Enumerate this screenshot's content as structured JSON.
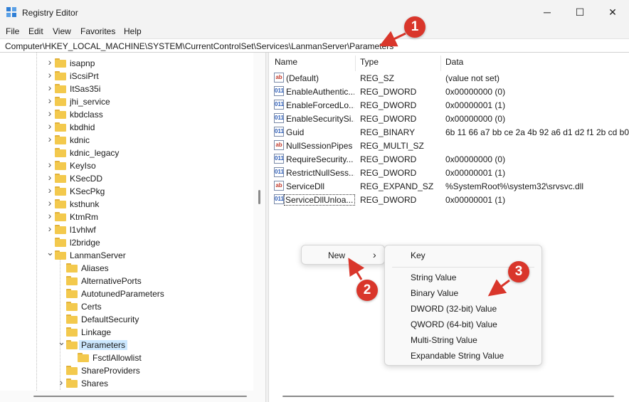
{
  "window": {
    "title": "Registry Editor",
    "minimize_glyph": "─",
    "maximize_glyph": "☐",
    "close_glyph": "✕"
  },
  "menu": [
    "File",
    "Edit",
    "View",
    "Favorites",
    "Help"
  ],
  "address": "Computer\\HKEY_LOCAL_MACHINE\\SYSTEM\\CurrentControlSet\\Services\\LanmanServer\\Parameters",
  "tree": [
    {
      "label": "isapnp",
      "expandable": true
    },
    {
      "label": "iScsiPrt",
      "expandable": true
    },
    {
      "label": "ItSas35i",
      "expandable": true
    },
    {
      "label": "jhi_service",
      "expandable": true
    },
    {
      "label": "kbdclass",
      "expandable": true
    },
    {
      "label": "kbdhid",
      "expandable": true
    },
    {
      "label": "kdnic",
      "expandable": true
    },
    {
      "label": "kdnic_legacy",
      "expandable": false
    },
    {
      "label": "KeyIso",
      "expandable": true
    },
    {
      "label": "KSecDD",
      "expandable": true
    },
    {
      "label": "KSecPkg",
      "expandable": true
    },
    {
      "label": "ksthunk",
      "expandable": true
    },
    {
      "label": "KtmRm",
      "expandable": true
    },
    {
      "label": "l1vhlwf",
      "expandable": true
    },
    {
      "label": "l2bridge",
      "expandable": false
    },
    {
      "label": "LanmanServer",
      "expandable": true,
      "expanded": true
    },
    {
      "label": "Aliases",
      "expandable": false
    },
    {
      "label": "AlternativePorts",
      "expandable": false
    },
    {
      "label": "AutotunedParameters",
      "expandable": false
    },
    {
      "label": "Certs",
      "expandable": false
    },
    {
      "label": "DefaultSecurity",
      "expandable": false
    },
    {
      "label": "Linkage",
      "expandable": false
    },
    {
      "label": "Parameters",
      "expandable": true,
      "expanded": true,
      "selected": true
    },
    {
      "label": "FsctlAllowlist",
      "expandable": false
    },
    {
      "label": "ShareProviders",
      "expandable": false
    },
    {
      "label": "Shares",
      "expandable": true
    }
  ],
  "columns": {
    "name": "Name",
    "type": "Type",
    "data": "Data"
  },
  "values": [
    {
      "icon": "ab",
      "kind": "string-value-icon",
      "name": "(Default)",
      "type": "REG_SZ",
      "data": "(value not set)"
    },
    {
      "icon": "011",
      "kind": "binary-value-icon",
      "name": "EnableAuthentic...",
      "type": "REG_DWORD",
      "data": "0x00000000 (0)"
    },
    {
      "icon": "011",
      "kind": "binary-value-icon",
      "name": "EnableForcedLo...",
      "type": "REG_DWORD",
      "data": "0x00000001 (1)"
    },
    {
      "icon": "011",
      "kind": "binary-value-icon",
      "name": "EnableSecuritySi...",
      "type": "REG_DWORD",
      "data": "0x00000000 (0)"
    },
    {
      "icon": "011",
      "kind": "binary-value-icon",
      "name": "Guid",
      "type": "REG_BINARY",
      "data": "6b 11 66 a7 bb ce 2a 4b 92 a6 d1 d2 f1 2b cd b0"
    },
    {
      "icon": "ab",
      "kind": "string-value-icon",
      "name": "NullSessionPipes",
      "type": "REG_MULTI_SZ",
      "data": ""
    },
    {
      "icon": "011",
      "kind": "binary-value-icon",
      "name": "RequireSecurity...",
      "type": "REG_DWORD",
      "data": "0x00000000 (0)"
    },
    {
      "icon": "011",
      "kind": "binary-value-icon",
      "name": "RestrictNullSess...",
      "type": "REG_DWORD",
      "data": "0x00000001 (1)"
    },
    {
      "icon": "ab",
      "kind": "string-value-icon",
      "name": "ServiceDll",
      "type": "REG_EXPAND_SZ",
      "data": "%SystemRoot%\\system32\\srvsvc.dll"
    },
    {
      "icon": "011",
      "kind": "binary-value-icon",
      "name": "ServiceDllUnloa...",
      "type": "REG_DWORD",
      "data": "0x00000001 (1)",
      "focused": true
    }
  ],
  "context_menu": {
    "new_label": "New",
    "submenu_arrow": "›",
    "submenu": {
      "key": "Key",
      "items": [
        "String Value",
        "Binary Value",
        "DWORD (32-bit) Value",
        "QWORD (64-bit) Value",
        "Multi-String Value",
        "Expandable String Value"
      ]
    }
  },
  "callouts": [
    "1",
    "2",
    "3"
  ],
  "colors": {
    "callout": "#d9362b",
    "selection": "#cce8ff",
    "folder": "#f3c94d"
  }
}
